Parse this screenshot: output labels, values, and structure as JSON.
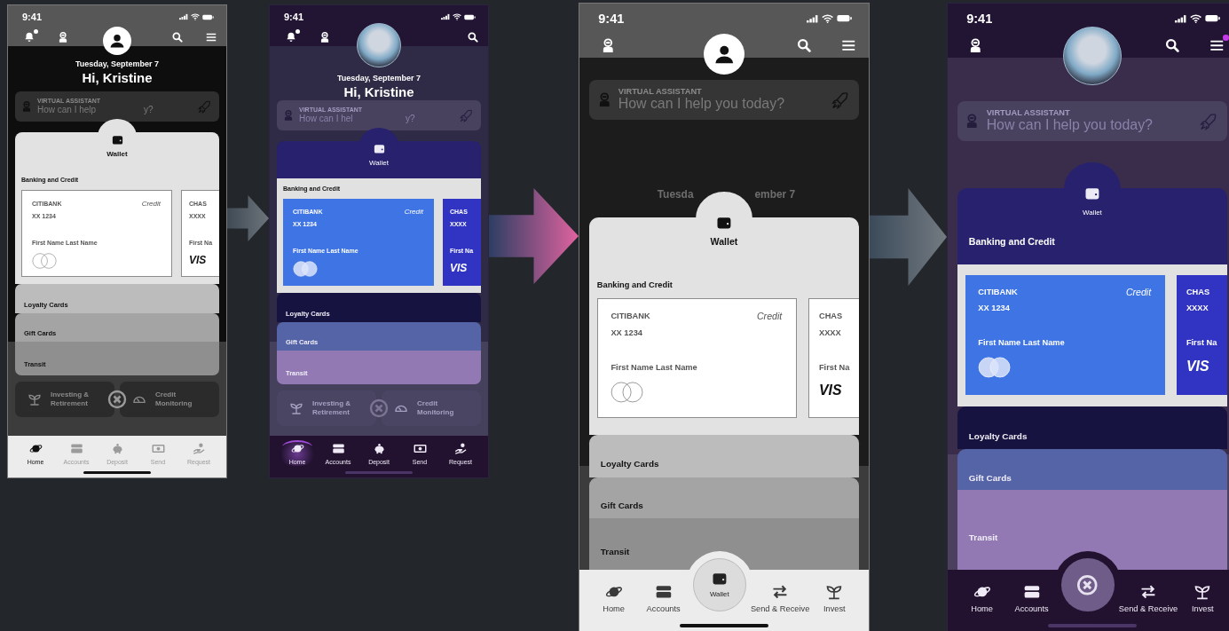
{
  "phones": [
    {
      "kind": "wireframe",
      "wallet_open": false,
      "photo_avatar": false,
      "status_time": "9:41",
      "top_actions": [
        {
          "kind": "bell",
          "badge": true
        },
        {
          "kind": "robot",
          "badge": false
        },
        {
          "kind": "search",
          "badge": false
        },
        {
          "kind": "menu",
          "badge": false
        }
      ],
      "date": "Tuesday, September 7",
      "greeting": "Hi, Kristine",
      "assistant": {
        "label": "VIRTUAL ASSISTANT",
        "placeholder": [
          "How can I help",
          "y?"
        ]
      },
      "wallet": {
        "title": "Wallet",
        "section": "Banking and Credit",
        "section_in_header": false,
        "cards": [
          {
            "kind": "mastercard",
            "bank": "CITIBANK",
            "type": "Credit",
            "number": "XX 1234",
            "holder": "First Name Last Name"
          },
          {
            "kind": "visa",
            "bank": "CHAS",
            "number": "XXXX",
            "holder": "First Na",
            "logo": "VIS"
          }
        ]
      },
      "stacks": [
        "Loyalty Cards",
        "Gift Cards",
        "Transit"
      ],
      "tiles": [
        {
          "kind": "plant",
          "label": "Investing & Retirement"
        },
        {
          "kind": "gauge",
          "label": "Credit Monitoring"
        }
      ],
      "close_button": true,
      "nav": [
        {
          "kind": "planet",
          "label": "Home",
          "selected": true
        },
        {
          "kind": "card",
          "label": "Accounts",
          "selected": false
        },
        {
          "kind": "piggy",
          "label": "Deposit",
          "selected": false
        },
        {
          "kind": "cash",
          "label": "Send",
          "selected": false
        },
        {
          "kind": "hand",
          "label": "Request",
          "selected": false
        }
      ]
    },
    {
      "kind": "purple",
      "wallet_open": false,
      "photo_avatar": true,
      "status_time": "9:41",
      "top_actions": [
        {
          "kind": "bell",
          "badge": true
        },
        {
          "kind": "robot",
          "badge": false
        },
        {
          "kind": "search",
          "badge": false
        }
      ],
      "date": "Tuesday, September 7",
      "greeting": "Hi, Kristine",
      "assistant": {
        "label": "VIRTUAL ASSISTANT",
        "placeholder": [
          "How can I hel",
          "y?"
        ]
      },
      "wallet": {
        "title": "Wallet",
        "section": "Banking and Credit",
        "section_in_header": false,
        "cards": [
          {
            "kind": "mastercard",
            "bank": "CITIBANK",
            "type": "Credit",
            "number": "XX 1234",
            "holder": "First Name Last Name"
          },
          {
            "kind": "visa",
            "bank": "CHAS",
            "number": "XXXX",
            "holder": "First Na",
            "logo": "VIS"
          }
        ]
      },
      "stacks": [
        "Loyalty Cards",
        "Gift Cards",
        "Transit"
      ],
      "tiles": [
        {
          "kind": "plant",
          "label": "Investing & Retirement"
        },
        {
          "kind": "gauge",
          "label": "Credit Monitoring"
        }
      ],
      "close_button": true,
      "nav": [
        {
          "kind": "planet",
          "label": "Home",
          "selected": true
        },
        {
          "kind": "card",
          "label": "Accounts",
          "selected": false
        },
        {
          "kind": "piggy",
          "label": "Deposit",
          "selected": false
        },
        {
          "kind": "cash",
          "label": "Send",
          "selected": false
        },
        {
          "kind": "hand",
          "label": "Request",
          "selected": false
        }
      ]
    },
    {
      "kind": "wireframe",
      "wallet_open": true,
      "photo_avatar": false,
      "status_time": "9:41",
      "top_actions": [
        {
          "kind": "robot",
          "badge": false
        },
        {
          "kind": "search",
          "badge": false
        },
        {
          "kind": "menu",
          "badge": false
        }
      ],
      "date_fragments": [
        "Tuesda",
        "ember 7"
      ],
      "assistant": {
        "label": "VIRTUAL ASSISTANT",
        "placeholder": [
          "How can I help you today?"
        ]
      },
      "wallet": {
        "title": "Wallet",
        "section": "Banking and Credit",
        "section_in_header": false,
        "cards": [
          {
            "kind": "mastercard",
            "bank": "CITIBANK",
            "type": "Credit",
            "number": "XX 1234",
            "holder": "First Name Last Name"
          },
          {
            "kind": "visa",
            "bank": "CHAS",
            "number": "XXXX",
            "holder": "First Na",
            "logo": "VIS"
          }
        ]
      },
      "stacks": [
        "Loyalty Cards",
        "Gift Cards",
        "Transit"
      ],
      "nav": [
        {
          "kind": "planet",
          "label": "Home",
          "selected": false
        },
        {
          "kind": "card",
          "label": "Accounts",
          "selected": false
        },
        {
          "kind": "wallet",
          "label": "Wallet",
          "selected": true
        },
        {
          "kind": "arrows",
          "label": "Send & Receive",
          "selected": false
        },
        {
          "kind": "plant",
          "label": "Invest",
          "selected": false
        }
      ]
    },
    {
      "kind": "purple",
      "wallet_open": true,
      "photo_avatar": true,
      "status_time": "9:41",
      "top_actions": [
        {
          "kind": "robot",
          "badge": false
        },
        {
          "kind": "search",
          "badge": false
        },
        {
          "kind": "menu",
          "badge": true
        }
      ],
      "assistant": {
        "label": "VIRTUAL ASSISTANT",
        "placeholder": [
          "How can I help you today?"
        ]
      },
      "wallet": {
        "title": "Wallet",
        "section": "Banking and Credit",
        "section_in_header": true,
        "cards": [
          {
            "kind": "mastercard",
            "bank": "CITIBANK",
            "type": "Credit",
            "number": "XX 1234",
            "holder": "First Name Last Name"
          },
          {
            "kind": "visa",
            "bank": "CHAS",
            "number": "XXXX",
            "holder": "First Na",
            "logo": "VIS"
          }
        ]
      },
      "stacks": [
        "Loyalty Cards",
        "Gift Cards",
        "Transit"
      ],
      "nav": [
        {
          "kind": "planet",
          "label": "Home",
          "selected": false
        },
        {
          "kind": "card",
          "label": "Accounts",
          "selected": false
        },
        {
          "kind": "close",
          "selected": false
        },
        {
          "kind": "arrows",
          "label": "Send & Receive",
          "selected": false
        },
        {
          "kind": "plant",
          "label": "Invest",
          "selected": false
        }
      ]
    }
  ]
}
